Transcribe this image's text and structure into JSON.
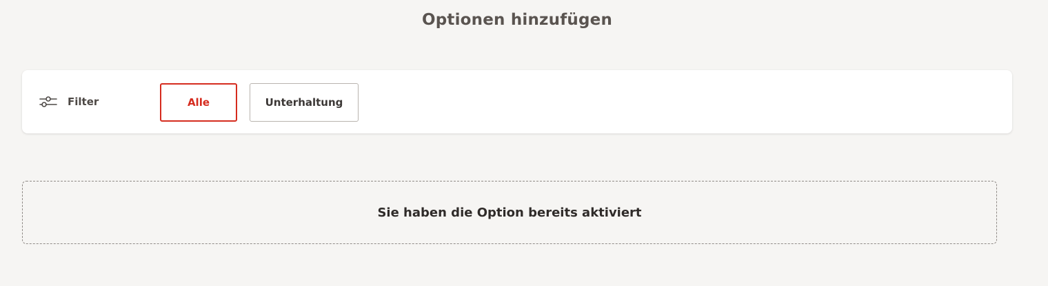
{
  "header": {
    "title": "Optionen hinzufügen"
  },
  "filter": {
    "icon": "sliders-icon",
    "label": "Filter",
    "chips": [
      {
        "label": "Alle",
        "selected": true
      },
      {
        "label": "Unterhaltung",
        "selected": false
      }
    ]
  },
  "notice": {
    "text": "Sie haben die Option bereits aktiviert"
  },
  "colors": {
    "background": "#f6f5f3",
    "accent": "#d52b1e",
    "card": "#ffffff",
    "text": "#2f2b29"
  }
}
